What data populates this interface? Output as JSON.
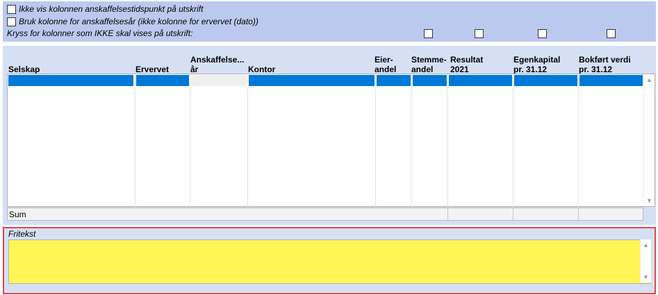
{
  "options": {
    "hide_acq_time": {
      "label": "Ikke vis kolonnen anskaffelsestidspunkt på utskrift",
      "checked": false
    },
    "use_acq_year": {
      "label": "Bruk kolonne for anskaffelsesår (ikke kolonne for ervervet (dato))",
      "checked": false
    },
    "hide_columns_label": "Kryss for kolonner som IKKE skal vises på utskrift:"
  },
  "grid": {
    "headers": {
      "selskap": "Selskap",
      "ervervet": "Ervervet",
      "anskaffelse_1": "Anskaffelse...",
      "anskaffelse_2": "år",
      "kontor": "Kontor",
      "eier_1": "Eier-",
      "eier_2": "andel",
      "stemme_1": "Stemme-",
      "stemme_2": "andel",
      "resultat_1": "Resultat",
      "resultat_2": "2021",
      "egenkapital_1": "Egenkapital",
      "egenkapital_2": "pr. 31.12",
      "bokfort_1": "Bokført verdi",
      "bokfort_2": "pr. 31.12"
    },
    "sum_label": "Sum"
  },
  "fritekst": {
    "label": "Fritekst",
    "value": ""
  },
  "colors": {
    "top_panel": "#bcc9ef",
    "grid_panel": "#d5e0f5",
    "selection": "#0078d7",
    "fritekst_bg": "#fff555",
    "focus_border": "#e04848"
  },
  "icons": {
    "scroll_up": "▲",
    "scroll_down": "▼"
  }
}
